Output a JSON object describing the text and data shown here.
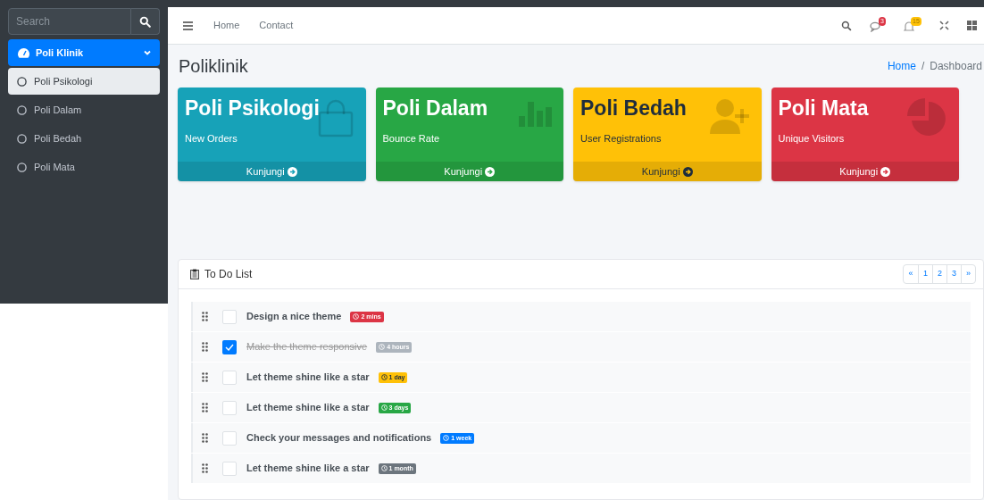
{
  "sidebar": {
    "search": {
      "placeholder": "Search"
    },
    "menu": {
      "label": "Poli Klinik",
      "expanded": true,
      "children": [
        {
          "label": "Poli Psikologi",
          "selected": true
        },
        {
          "label": "Poli Dalam",
          "selected": false
        },
        {
          "label": "Poli Bedah",
          "selected": false
        },
        {
          "label": "Poli Mata",
          "selected": false
        }
      ]
    }
  },
  "navbar": {
    "links": [
      "Home",
      "Contact"
    ],
    "messages_badge": "3",
    "notifications_badge": "15"
  },
  "page": {
    "title": "Poliklinik",
    "breadcrumb": [
      "Home",
      "Dashboard"
    ],
    "breadcrumb_separator": "/"
  },
  "cards": [
    {
      "title": "Poli Psikologi",
      "subtitle": "New Orders",
      "link": "Kunjungi",
      "color": "#17a2b8",
      "kind": "bag"
    },
    {
      "title": "Poli Dalam",
      "subtitle": "Bounce Rate",
      "link": "Kunjungi",
      "color": "#28a745",
      "kind": "chart"
    },
    {
      "title": "Poli Bedah",
      "subtitle": "User Registrations",
      "link": "Kunjungi",
      "color": "#ffc107",
      "kind": "user-plus"
    },
    {
      "title": "Poli Mata",
      "subtitle": "Unique Visitors",
      "link": "Kunjungi",
      "color": "#dc3545",
      "kind": "pie"
    }
  ],
  "todo": {
    "title": "To Do List",
    "pagination": [
      "«",
      "1",
      "2",
      "3",
      "»"
    ],
    "items": [
      {
        "text": "Design a nice theme",
        "checked": false,
        "badge": "2 mins",
        "color": "#dc3545"
      },
      {
        "text": "Make the theme responsive",
        "checked": true,
        "badge": "4 hours",
        "color": "#adb5bd"
      },
      {
        "text": "Let theme shine like a star",
        "checked": false,
        "badge": "1 day",
        "color": "#ffc107"
      },
      {
        "text": "Let theme shine like a star",
        "checked": false,
        "badge": "3 days",
        "color": "#28a745"
      },
      {
        "text": "Check your messages and notifications",
        "checked": false,
        "badge": "1 week",
        "color": "#007bff"
      },
      {
        "text": "Let theme shine like a star",
        "checked": false,
        "badge": "1 month",
        "color": "#6c757d"
      }
    ]
  }
}
